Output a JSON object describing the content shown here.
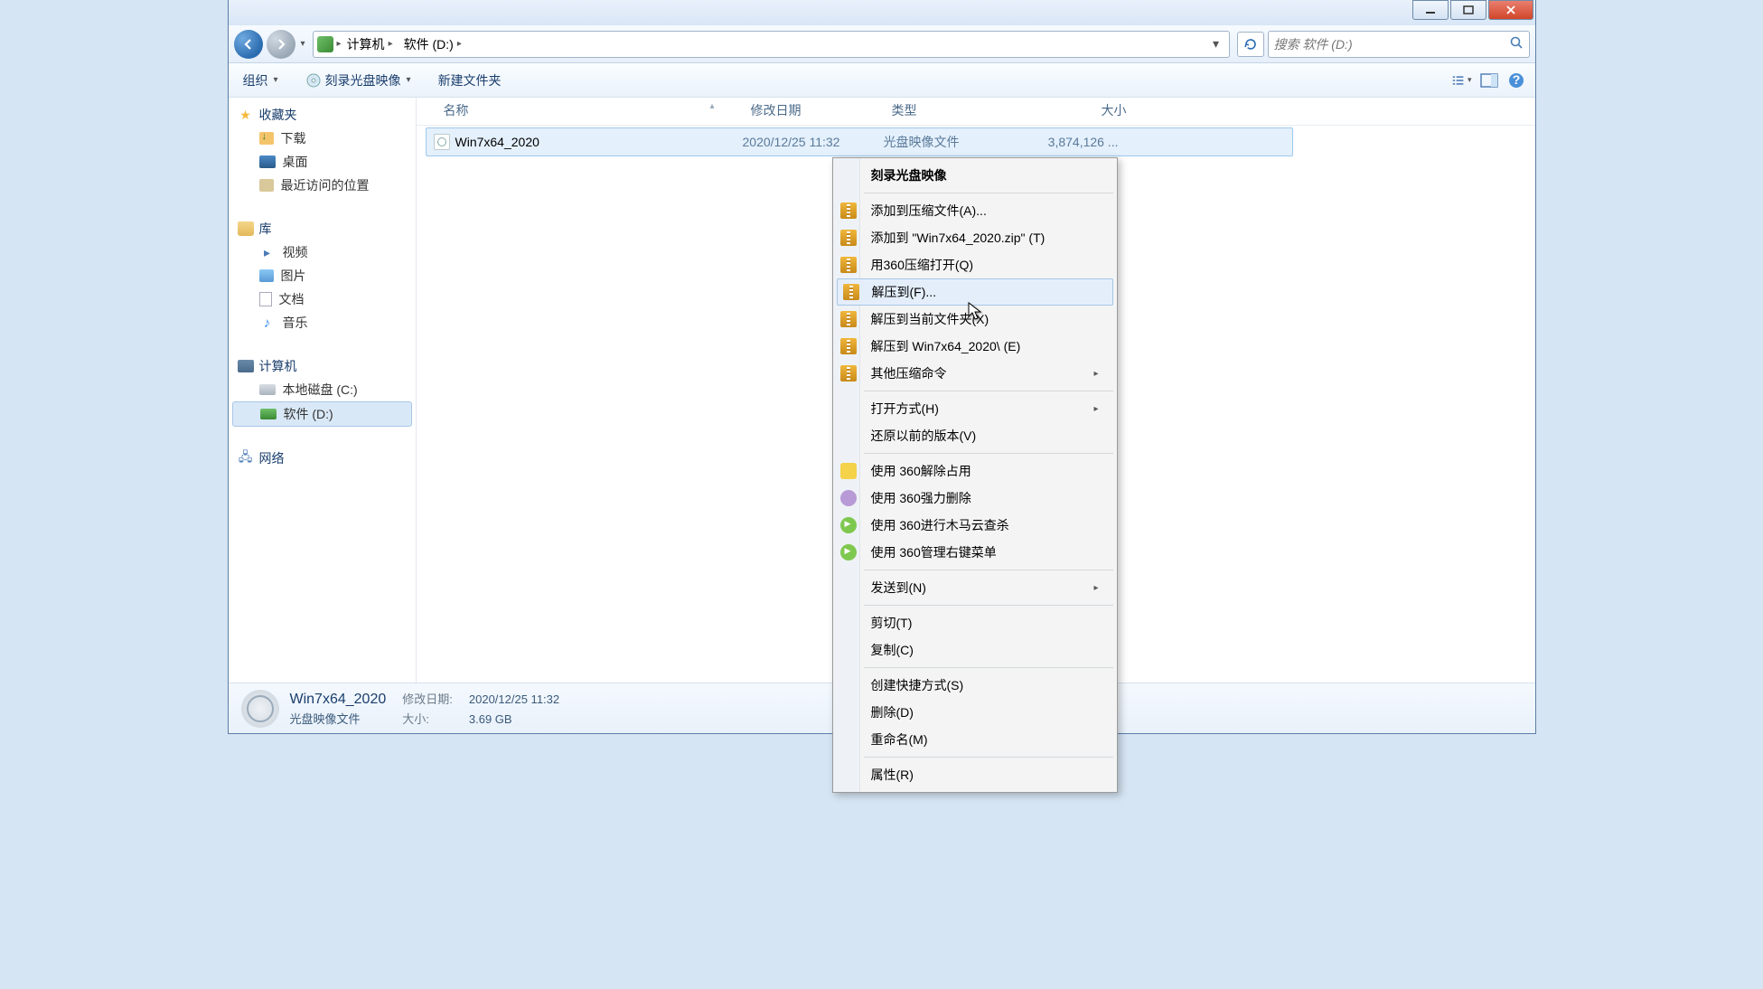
{
  "titlebar": {
    "minimize": "–",
    "maximize": "□",
    "close": "×"
  },
  "nav": {
    "breadcrumb": [
      "计算机",
      "软件 (D:)"
    ],
    "search_placeholder": "搜索 软件 (D:)"
  },
  "toolbar": {
    "organize": "组织",
    "burn": "刻录光盘映像",
    "newfolder": "新建文件夹"
  },
  "sidebar": {
    "favorites": {
      "head": "收藏夹",
      "items": [
        "下载",
        "桌面",
        "最近访问的位置"
      ]
    },
    "libraries": {
      "head": "库",
      "items": [
        "视频",
        "图片",
        "文档",
        "音乐"
      ]
    },
    "computer": {
      "head": "计算机",
      "items": [
        "本地磁盘 (C:)",
        "软件 (D:)"
      ]
    },
    "network": {
      "head": "网络"
    }
  },
  "columns": {
    "name": "名称",
    "date": "修改日期",
    "type": "类型",
    "size": "大小"
  },
  "file": {
    "name": "Win7x64_2020",
    "date": "2020/12/25 11:32",
    "type": "光盘映像文件",
    "size": "3,874,126 ..."
  },
  "context_menu": {
    "burn_image": "刻录光盘映像",
    "add_archive": "添加到压缩文件(A)...",
    "add_zip": "添加到 \"Win7x64_2020.zip\" (T)",
    "open_360zip": "用360压缩打开(Q)",
    "extract_to": "解压到(F)...",
    "extract_here": "解压到当前文件夹(X)",
    "extract_named": "解压到 Win7x64_2020\\ (E)",
    "other_zip": "其他压缩命令",
    "open_with": "打开方式(H)",
    "restore_prev": "还原以前的版本(V)",
    "use_360_unlock": "使用 360解除占用",
    "use_360_force": "使用 360强力删除",
    "use_360_scan": "使用 360进行木马云查杀",
    "use_360_menu": "使用 360管理右键菜单",
    "send_to": "发送到(N)",
    "cut": "剪切(T)",
    "copy": "复制(C)",
    "shortcut": "创建快捷方式(S)",
    "delete": "删除(D)",
    "rename": "重命名(M)",
    "properties": "属性(R)"
  },
  "details": {
    "name": "Win7x64_2020",
    "type": "光盘映像文件",
    "date_lbl": "修改日期:",
    "date": "2020/12/25 11:32",
    "size_lbl": "大小:",
    "size": "3.69 GB"
  }
}
